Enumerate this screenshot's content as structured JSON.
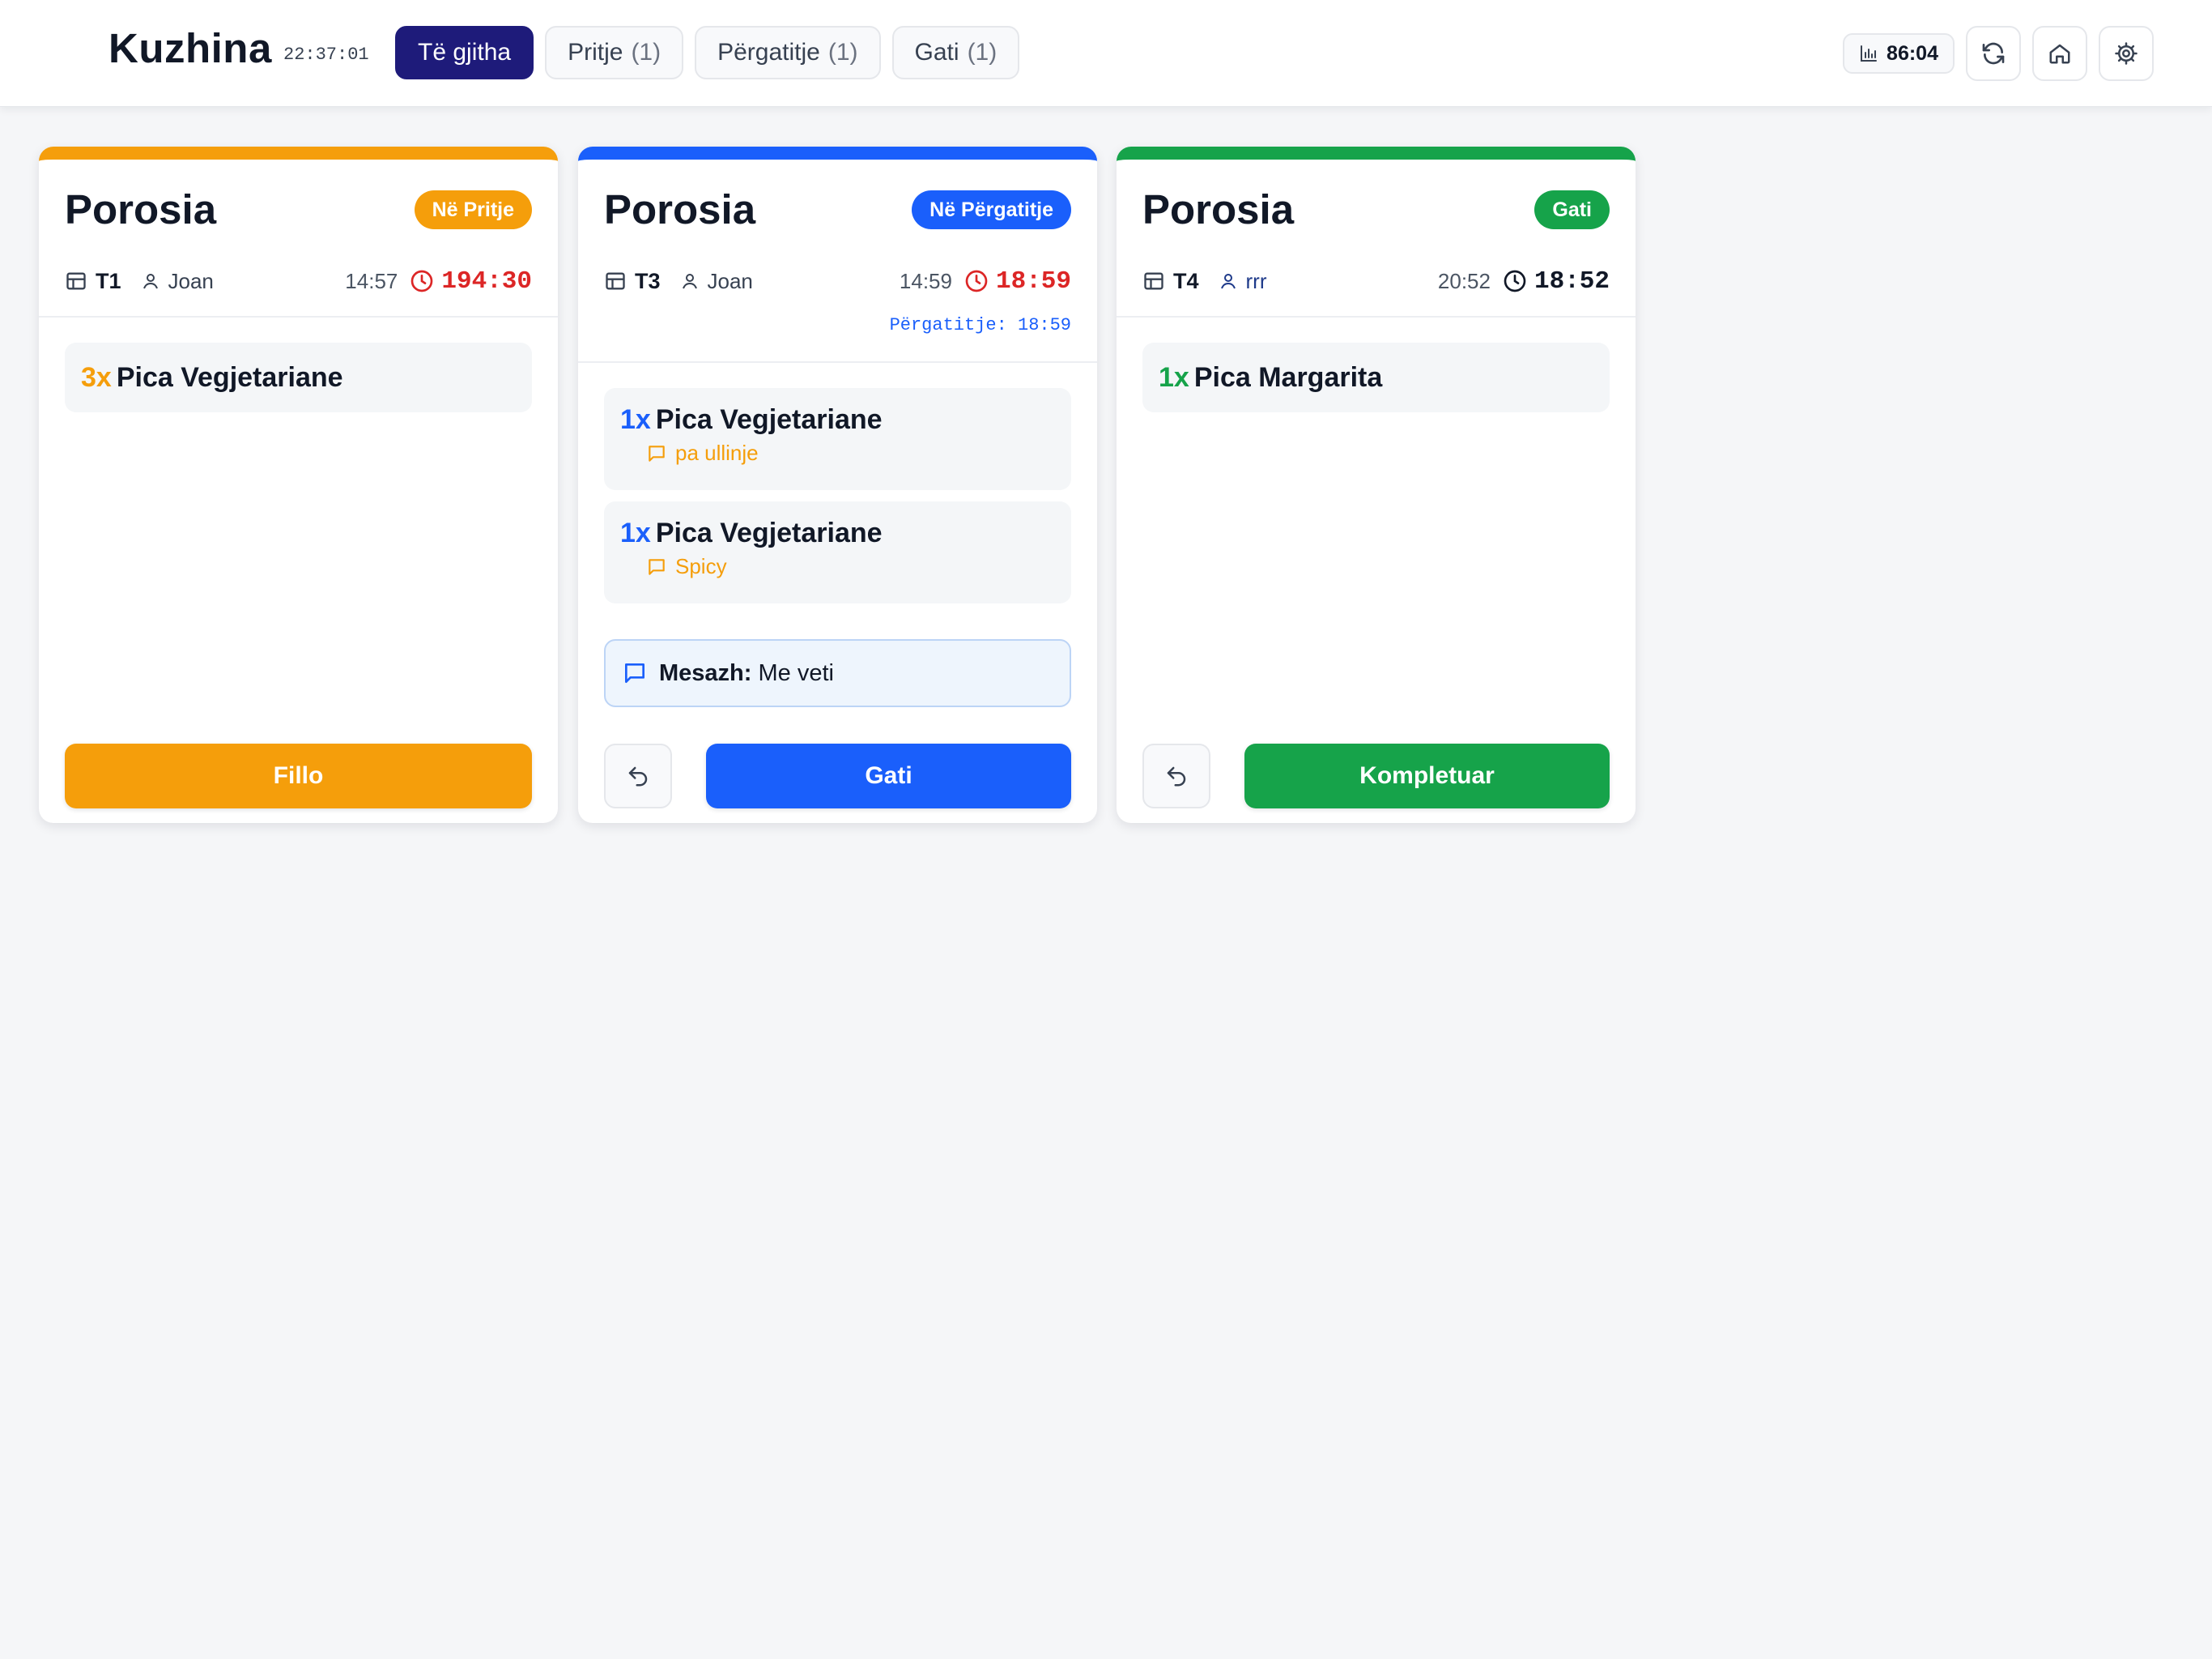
{
  "header": {
    "title": "Kuzhina",
    "clock": "22:37:01",
    "tabs": [
      {
        "label": "Të gjitha",
        "count": "",
        "active": true
      },
      {
        "label": "Pritje",
        "count": "(1)",
        "active": false
      },
      {
        "label": "Përgatitje",
        "count": "(1)",
        "active": false
      },
      {
        "label": "Gati",
        "count": "(1)",
        "active": false
      }
    ],
    "stat": {
      "icon": "bar-chart-icon",
      "value": "86:04"
    },
    "buttons": [
      {
        "icon": "refresh-icon"
      },
      {
        "icon": "home-icon"
      },
      {
        "icon": "gear-icon"
      }
    ]
  },
  "colors": {
    "pending": "#f59e0b",
    "preparing": "#1a5ffb",
    "ready": "#16a34a",
    "active_tab": "#1e1b7a",
    "overdue": "#dc2626"
  },
  "orders": [
    {
      "title": "Porosia",
      "status": "Në Pritje",
      "table": "T1",
      "waiter": "Joan",
      "time": "14:57",
      "elapsed": "194:30",
      "items": [
        {
          "qty": "3x",
          "name": "Pica Vegjetariane"
        }
      ],
      "action": "Fillo"
    },
    {
      "title": "Porosia",
      "status": "Në Përgatitje",
      "table": "T3",
      "waiter": "Joan",
      "time": "14:59",
      "elapsed": "18:59",
      "prep_label": "Përgatitje: 18:59",
      "items": [
        {
          "qty": "1x",
          "name": "Pica Vegjetariane",
          "note": "pa ullinje"
        },
        {
          "qty": "1x",
          "name": "Pica Vegjetariane",
          "note": "Spicy"
        }
      ],
      "message_label": "Mesazh:",
      "message": "Me veti",
      "action": "Gati"
    },
    {
      "title": "Porosia",
      "status": "Gati",
      "table": "T4",
      "waiter": "rrr",
      "time": "20:52",
      "elapsed": "18:52",
      "items": [
        {
          "qty": "1x",
          "name": "Pica Margarita"
        }
      ],
      "action": "Kompletuar"
    }
  ]
}
